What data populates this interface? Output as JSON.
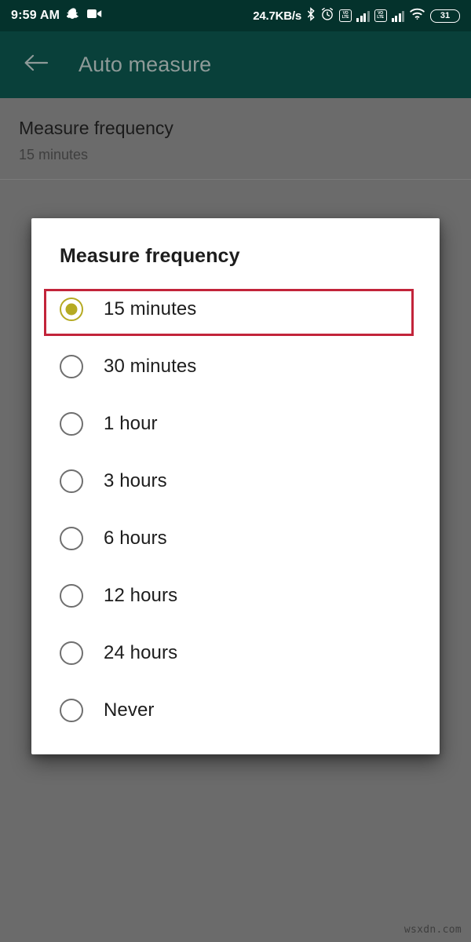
{
  "status_bar": {
    "clock": "9:59 AM",
    "network_speed": "24.7KB/s",
    "battery_level": "31",
    "volte_line1": "VO",
    "volte_line2": "LTE",
    "icons": [
      "snapchat-icon",
      "video-camera-icon",
      "bluetooth-icon",
      "alarm-clock-icon",
      "volte-icon",
      "signal-bars-icon",
      "wifi-icon",
      "battery-icon"
    ],
    "background_color": "#04322c"
  },
  "app_bar": {
    "title": "Auto measure",
    "back_icon": "back-arrow-icon",
    "background_color": "#09403a",
    "title_color": "#8e9a98"
  },
  "settings": {
    "preference": {
      "title": "Measure frequency",
      "summary": "15 minutes"
    }
  },
  "dialog": {
    "title": "Measure frequency",
    "selected_index": 0,
    "accent_color": "#b5aa22",
    "options": [
      {
        "label": "15 minutes",
        "selected": true
      },
      {
        "label": "30 minutes",
        "selected": false
      },
      {
        "label": "1 hour",
        "selected": false
      },
      {
        "label": "3 hours",
        "selected": false
      },
      {
        "label": "6 hours",
        "selected": false
      },
      {
        "label": "12 hours",
        "selected": false
      },
      {
        "label": "24 hours",
        "selected": false
      },
      {
        "label": "Never",
        "selected": false
      }
    ]
  },
  "annotation": {
    "highlight_color": "#c2243a",
    "target_option": "15 minutes"
  },
  "watermark": {
    "text": "wsxdn.com"
  }
}
